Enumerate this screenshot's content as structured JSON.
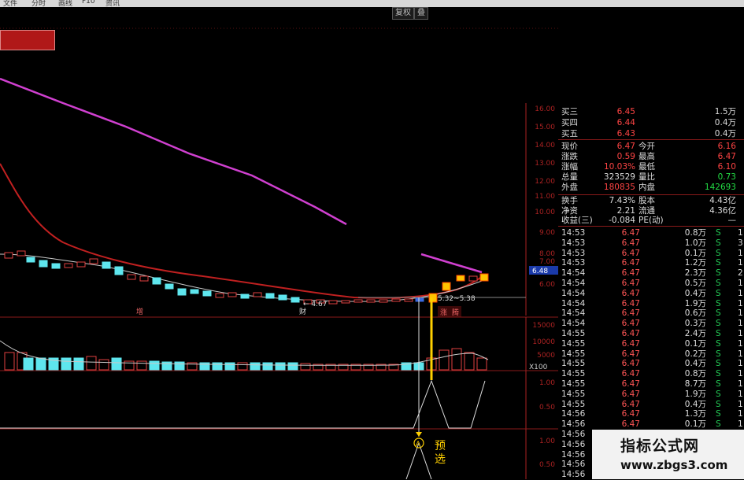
{
  "top_buttons": [
    "复权",
    "叠"
  ],
  "axis": {
    "price_ticks": [
      "16.00",
      "15.00",
      "14.00",
      "13.00",
      "12.00",
      "11.00",
      "10.00",
      "9.00",
      "8.00",
      "7.00",
      "6.00"
    ],
    "price_marker": "6.48",
    "volume_ticks": [
      "15000",
      "10000",
      "5000"
    ],
    "volume_unit": "X100",
    "ind1_ticks": [
      "1.00",
      "0.50"
    ],
    "ind2_ticks": [
      "1.00",
      "0.50"
    ]
  },
  "annotations": {
    "low_label": "4.67",
    "range_label": "5.32~5.38",
    "event1": "增",
    "event2": "财",
    "event3": "涨",
    "event4": "腾",
    "signal_char": "A",
    "signal_text1": "预",
    "signal_text2": "选"
  },
  "quote": {
    "asks": [
      {
        "label": "买三",
        "price": "6.45",
        "vol": "1.5万"
      },
      {
        "label": "买四",
        "price": "6.44",
        "vol": "0.4万"
      },
      {
        "label": "买五",
        "price": "6.43",
        "vol": "0.4万"
      }
    ],
    "stats": [
      {
        "l1": "现价",
        "v1": "6.47",
        "l2": "今开",
        "v2": "6.16"
      },
      {
        "l1": "涨跌",
        "v1": "0.59",
        "l2": "最高",
        "v2": "6.47"
      },
      {
        "l1": "涨幅",
        "v1": "10.03%",
        "l2": "最低",
        "v2": "6.10"
      },
      {
        "l1": "总量",
        "v1": "323529",
        "l2": "量比",
        "v2": "0.73"
      },
      {
        "l1": "外盘",
        "v1": "180835",
        "l2": "内盘",
        "v2": "142693"
      }
    ],
    "stats2": [
      {
        "l1": "换手",
        "v1": "7.43%",
        "l2": "股本",
        "v2": "4.43亿"
      },
      {
        "l1": "净资",
        "v1": "2.21",
        "l2": "流通",
        "v2": "4.36亿"
      },
      {
        "l1": "收益(三)",
        "v1": "-0.084",
        "l2": "PE(动)",
        "v2": "—"
      }
    ]
  },
  "ticks": [
    {
      "t": "14:53",
      "p": "6.47",
      "v": "0.8万",
      "s": "S",
      "n": "1"
    },
    {
      "t": "14:53",
      "p": "6.47",
      "v": "1.0万",
      "s": "S",
      "n": "3"
    },
    {
      "t": "14:53",
      "p": "6.47",
      "v": "0.1万",
      "s": "S",
      "n": "1"
    },
    {
      "t": "14:53",
      "p": "6.47",
      "v": "1.2万",
      "s": "S",
      "n": "1"
    },
    {
      "t": "14:54",
      "p": "6.47",
      "v": "2.3万",
      "s": "S",
      "n": "2"
    },
    {
      "t": "14:54",
      "p": "6.47",
      "v": "0.5万",
      "s": "S",
      "n": "1"
    },
    {
      "t": "14:54",
      "p": "6.47",
      "v": "0.4万",
      "s": "S",
      "n": "1"
    },
    {
      "t": "14:54",
      "p": "6.47",
      "v": "1.9万",
      "s": "S",
      "n": "1"
    },
    {
      "t": "14:54",
      "p": "6.47",
      "v": "0.6万",
      "s": "S",
      "n": "1"
    },
    {
      "t": "14:54",
      "p": "6.47",
      "v": "0.3万",
      "s": "S",
      "n": "1"
    },
    {
      "t": "14:55",
      "p": "6.47",
      "v": "2.4万",
      "s": "S",
      "n": "1"
    },
    {
      "t": "14:55",
      "p": "6.47",
      "v": "0.1万",
      "s": "S",
      "n": "1"
    },
    {
      "t": "14:55",
      "p": "6.47",
      "v": "0.2万",
      "s": "S",
      "n": "1"
    },
    {
      "t": "14:55",
      "p": "6.47",
      "v": "0.4万",
      "s": "S",
      "n": "1"
    },
    {
      "t": "14:55",
      "p": "6.47",
      "v": "0.8万",
      "s": "S",
      "n": "1"
    },
    {
      "t": "14:55",
      "p": "6.47",
      "v": "8.7万",
      "s": "S",
      "n": "1"
    },
    {
      "t": "14:55",
      "p": "6.47",
      "v": "1.9万",
      "s": "S",
      "n": "1"
    },
    {
      "t": "14:55",
      "p": "6.47",
      "v": "0.4万",
      "s": "S",
      "n": "1"
    },
    {
      "t": "14:56",
      "p": "6.47",
      "v": "1.3万",
      "s": "S",
      "n": "1"
    },
    {
      "t": "14:56",
      "p": "6.47",
      "v": "0.1万",
      "s": "S",
      "n": "1"
    },
    {
      "t": "14:56",
      "p": "6.47",
      "v": "1.3万",
      "s": "S",
      "n": "1"
    },
    {
      "t": "14:56",
      "p": "",
      "v": "",
      "s": "",
      "n": ""
    },
    {
      "t": "14:56",
      "p": "",
      "v": "",
      "s": "",
      "n": ""
    },
    {
      "t": "14:56",
      "p": "",
      "v": "",
      "s": "",
      "n": ""
    },
    {
      "t": "14:56",
      "p": "",
      "v": "",
      "s": "",
      "n": ""
    }
  ],
  "watermark": {
    "line1": "指标公式网",
    "line2": "www.zbgs3.com"
  }
}
